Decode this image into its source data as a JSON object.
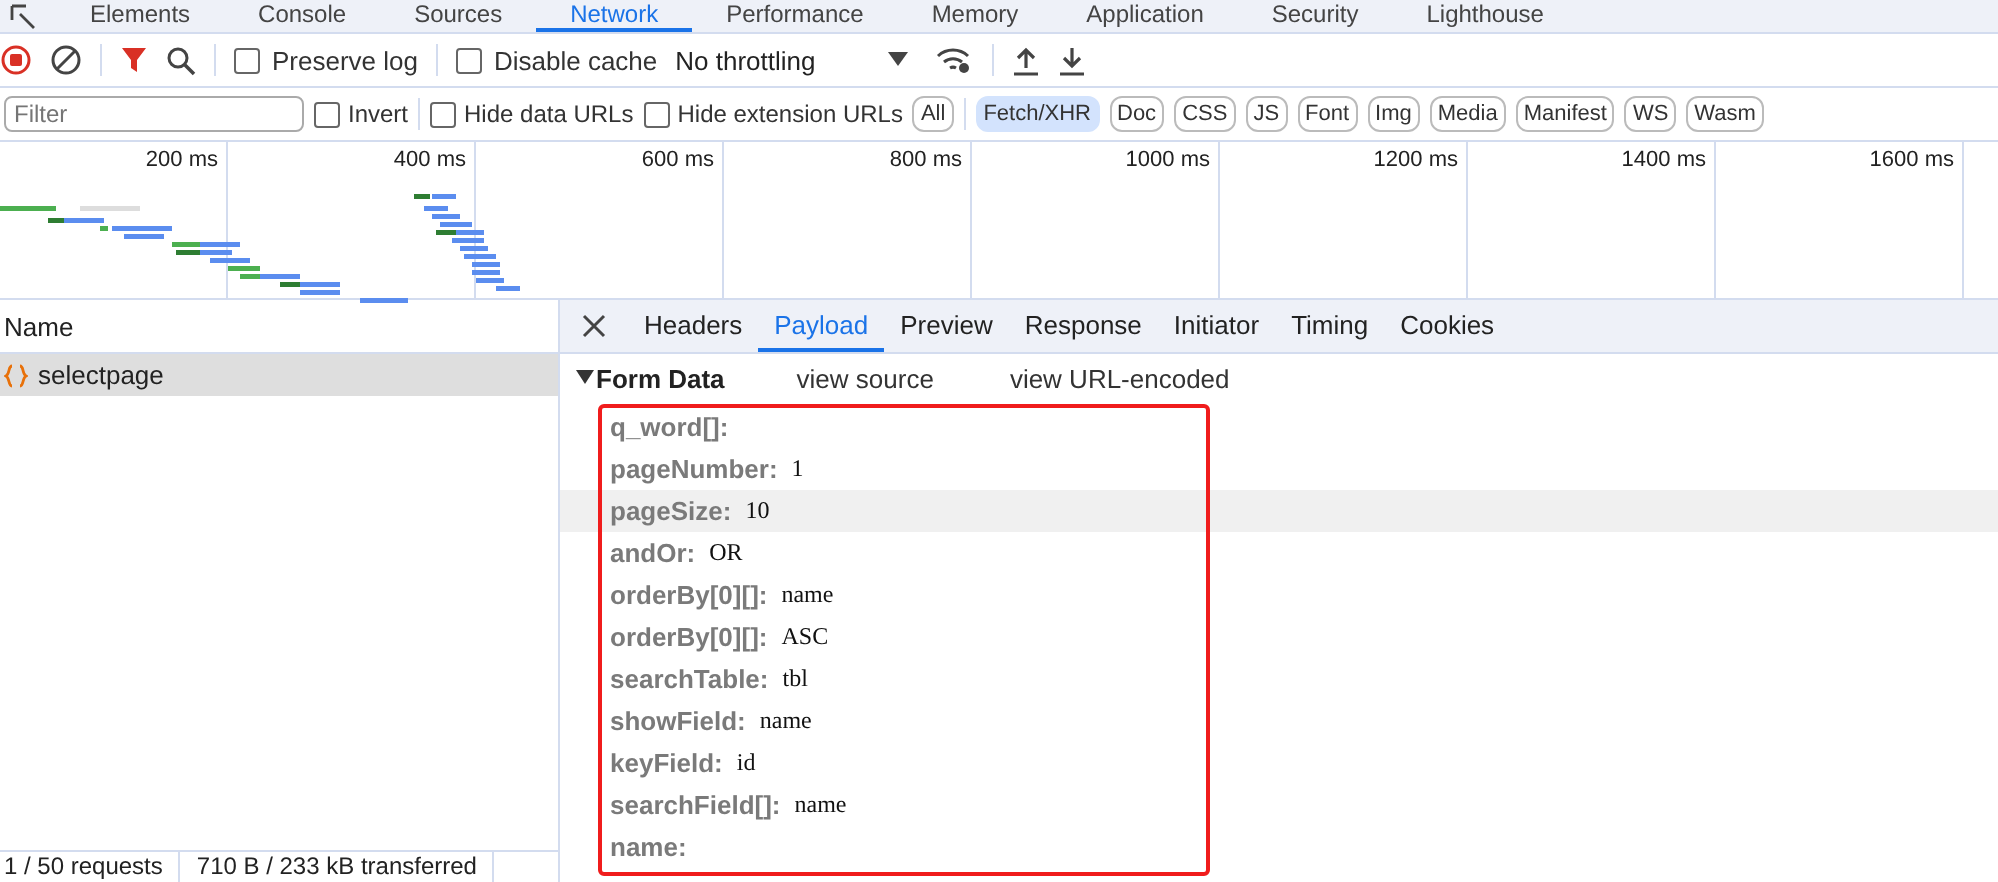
{
  "panel_tabs": [
    {
      "label": "Elements",
      "selected": false
    },
    {
      "label": "Console",
      "selected": false
    },
    {
      "label": "Sources",
      "selected": false
    },
    {
      "label": "Network",
      "selected": true
    },
    {
      "label": "Performance",
      "selected": false
    },
    {
      "label": "Memory",
      "selected": false
    },
    {
      "label": "Application",
      "selected": false
    },
    {
      "label": "Security",
      "selected": false
    },
    {
      "label": "Lighthouse",
      "selected": false
    }
  ],
  "toolbar": {
    "preserve_log": {
      "label": "Preserve log",
      "checked": false
    },
    "disable_cache": {
      "label": "Disable cache",
      "checked": false
    },
    "throttling": "No throttling"
  },
  "filter_bar": {
    "placeholder": "Filter",
    "invert": {
      "label": "Invert",
      "checked": false
    },
    "hide_data_urls": {
      "label": "Hide data URLs",
      "checked": false
    },
    "hide_extension_urls": {
      "label": "Hide extension URLs",
      "checked": false
    },
    "types": [
      {
        "label": "All",
        "selected": false
      },
      {
        "label": "Fetch/XHR",
        "selected": true
      },
      {
        "label": "Doc",
        "selected": false
      },
      {
        "label": "CSS",
        "selected": false
      },
      {
        "label": "JS",
        "selected": false
      },
      {
        "label": "Font",
        "selected": false
      },
      {
        "label": "Img",
        "selected": false
      },
      {
        "label": "Media",
        "selected": false
      },
      {
        "label": "Manifest",
        "selected": false
      },
      {
        "label": "WS",
        "selected": false
      },
      {
        "label": "Wasm",
        "selected": false
      }
    ]
  },
  "timeline": {
    "ticks": [
      "200 ms",
      "400 ms",
      "600 ms",
      "800 ms",
      "1000 ms",
      "1200 ms",
      "1400 ms",
      "1600 ms"
    ]
  },
  "requests": {
    "column": "Name",
    "rows": [
      {
        "name": "selectpage",
        "selected": true
      }
    ]
  },
  "detail_tabs": [
    {
      "label": "Headers",
      "selected": false
    },
    {
      "label": "Payload",
      "selected": true
    },
    {
      "label": "Preview",
      "selected": false
    },
    {
      "label": "Response",
      "selected": false
    },
    {
      "label": "Initiator",
      "selected": false
    },
    {
      "label": "Timing",
      "selected": false
    },
    {
      "label": "Cookies",
      "selected": false
    }
  ],
  "form_data": {
    "title": "Form Data",
    "expanded": true,
    "links": [
      "view source",
      "view URL-encoded"
    ],
    "fields": [
      {
        "key": "q_word[]:",
        "hovered": false
      },
      {
        "key": "pageNumber:",
        "value": "1",
        "hovered": false
      },
      {
        "key": "pageSize:",
        "value": "10",
        "hovered": true
      },
      {
        "key": "andOr:",
        "value": "OR",
        "hovered": false
      },
      {
        "key": "orderBy[0][]:",
        "value": "name",
        "hovered": false
      },
      {
        "key": "orderBy[0][]:",
        "value": "ASC",
        "hovered": false
      },
      {
        "key": "searchTable:",
        "value": "tbl",
        "hovered": false
      },
      {
        "key": "showField:",
        "value": "name",
        "hovered": false
      },
      {
        "key": "keyField:",
        "value": "id",
        "hovered": false
      },
      {
        "key": "searchField[]:",
        "value": "name",
        "hovered": false
      },
      {
        "key": "name:",
        "hovered": false
      }
    ]
  },
  "status_bar": [
    "1 / 50 requests",
    "710 B / 233 kB transferred"
  ]
}
